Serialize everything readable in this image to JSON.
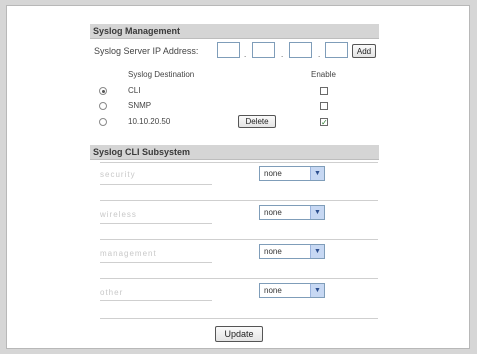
{
  "syslog_management": {
    "title": "Syslog Management",
    "ip_label": "Syslog Server IP Address:",
    "ip_octets": [
      "",
      "",
      "",
      ""
    ],
    "ip_separator": ".",
    "add_label": "Add",
    "dest_header": "Syslog Destination",
    "enable_header": "Enable",
    "destinations": [
      {
        "label": "CLI",
        "selected": true,
        "enabled": false
      },
      {
        "label": "SNMP",
        "selected": false,
        "enabled": false
      },
      {
        "label": "10.10.20.50",
        "selected": false,
        "enabled": true
      }
    ],
    "delete_label": "Delete",
    "check_mark": "✓"
  },
  "cli_subsystem": {
    "title": "Syslog CLI Subsystem",
    "rows": [
      {
        "label": "security",
        "value": "none"
      },
      {
        "label": "wireless",
        "value": "none"
      },
      {
        "label": "management",
        "value": "none"
      },
      {
        "label": "other",
        "value": "none"
      }
    ],
    "arrow_glyph": "▼"
  },
  "update_label": "Update",
  "colors": {
    "header_bg": "#d5d5d5",
    "page_bg": "#d6d6d6",
    "check": "#2e7d32"
  }
}
